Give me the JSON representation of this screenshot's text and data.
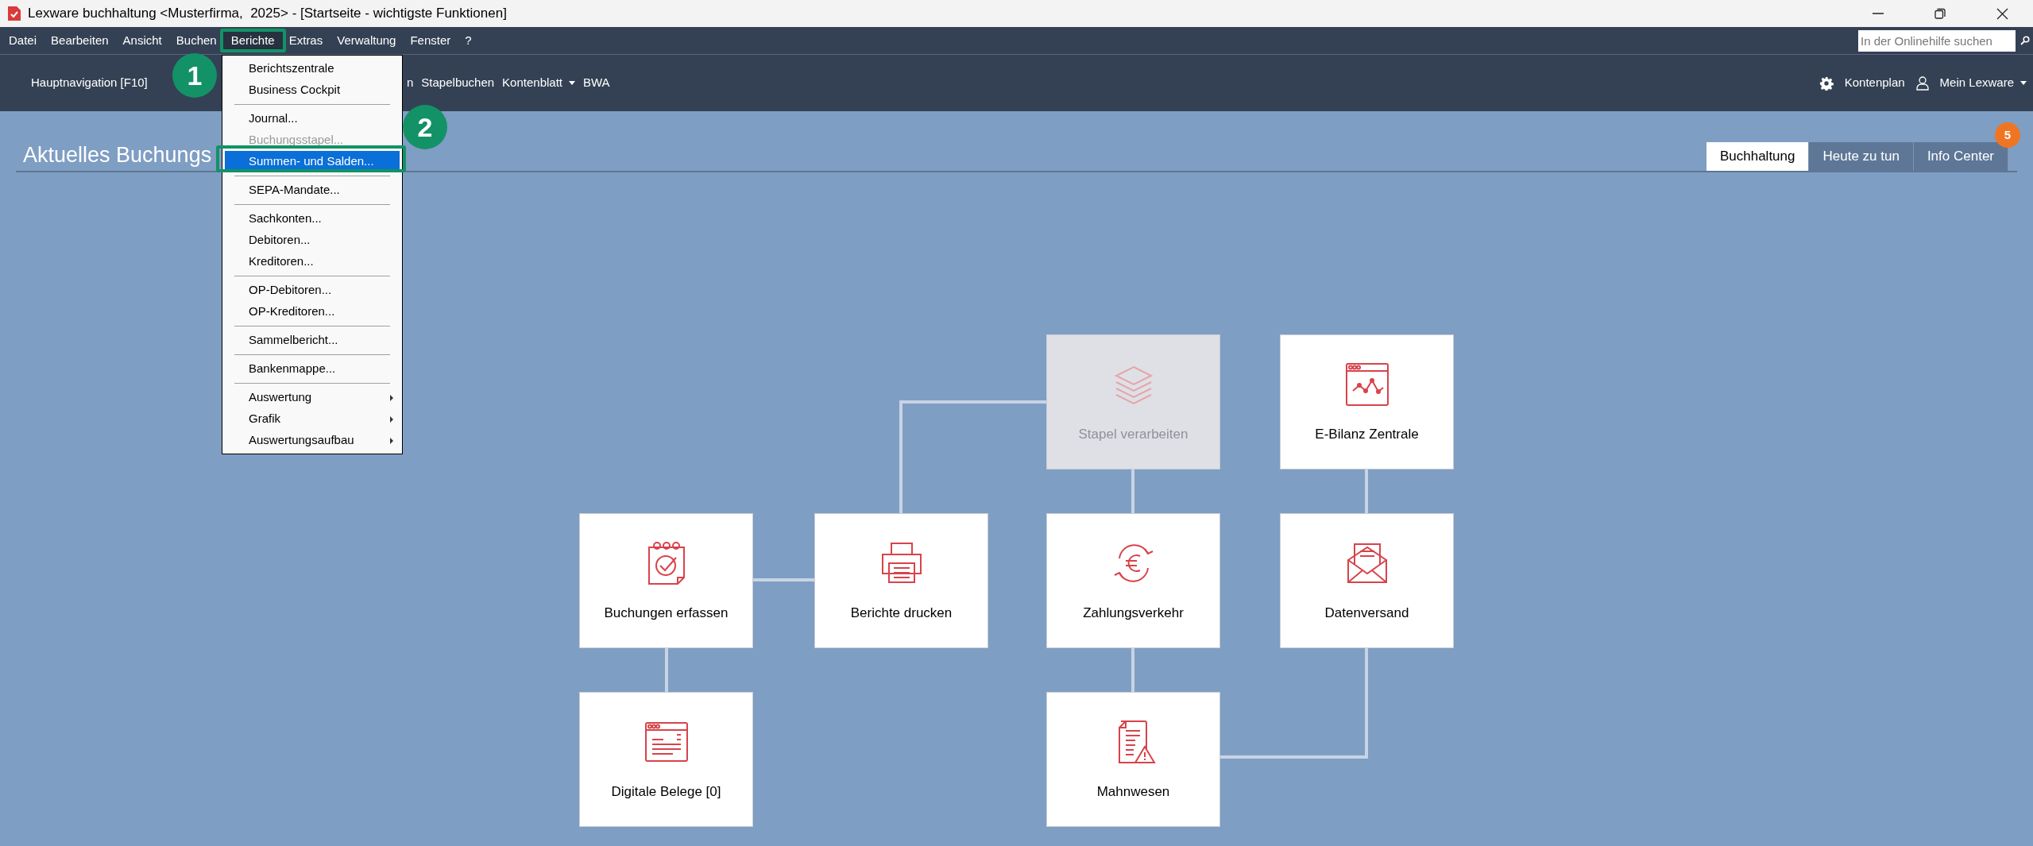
{
  "window": {
    "title": "Lexware buchhaltung <Musterfirma,  2025> - [Startseite - wichtigste Funktionen]"
  },
  "menubar": [
    {
      "label": "Datei",
      "selected": false
    },
    {
      "label": "Bearbeiten",
      "selected": false
    },
    {
      "label": "Ansicht",
      "selected": false
    },
    {
      "label": "Buchen",
      "selected": false
    },
    {
      "label": "Berichte",
      "selected": true
    },
    {
      "label": "Extras",
      "selected": false
    },
    {
      "label": "Verwaltung",
      "selected": false
    },
    {
      "label": "Fenster",
      "selected": false
    },
    {
      "label": "?",
      "selected": false
    }
  ],
  "help_search": {
    "placeholder": "In der Onlinehilfe suchen"
  },
  "nav": {
    "main": "Hauptnavigation [F10]",
    "items": [
      {
        "label": "n",
        "dropdown": false
      },
      {
        "label": "Stapelbuchen",
        "dropdown": false
      },
      {
        "label": "Kontenblatt",
        "dropdown": true
      },
      {
        "label": "BWA",
        "dropdown": false
      }
    ],
    "right": [
      {
        "label": "Kontenplan",
        "dropdown": false
      },
      {
        "label": "Mein Lexware",
        "dropdown": true
      }
    ]
  },
  "dropdown": [
    {
      "kind": "item",
      "label": "Berichtszentrale",
      "disabled": false,
      "selected": false,
      "submenu": false
    },
    {
      "kind": "item",
      "label": "Business Cockpit",
      "disabled": false,
      "selected": false,
      "submenu": false
    },
    {
      "kind": "separator"
    },
    {
      "kind": "item",
      "label": "Journal...",
      "disabled": false,
      "selected": false,
      "submenu": false
    },
    {
      "kind": "item",
      "label": "Buchungsstapel...",
      "disabled": true,
      "selected": false,
      "submenu": false
    },
    {
      "kind": "item",
      "label": "Summen- und Salden...",
      "disabled": false,
      "selected": true,
      "submenu": false
    },
    {
      "kind": "separator"
    },
    {
      "kind": "item",
      "label": "SEPA-Mandate...",
      "disabled": false,
      "selected": false,
      "submenu": false
    },
    {
      "kind": "separator"
    },
    {
      "kind": "item",
      "label": "Sachkonten...",
      "disabled": false,
      "selected": false,
      "submenu": false
    },
    {
      "kind": "item",
      "label": "Debitoren...",
      "disabled": false,
      "selected": false,
      "submenu": false
    },
    {
      "kind": "item",
      "label": "Kreditoren...",
      "disabled": false,
      "selected": false,
      "submenu": false
    },
    {
      "kind": "separator"
    },
    {
      "kind": "item",
      "label": "OP-Debitoren...",
      "disabled": false,
      "selected": false,
      "submenu": false
    },
    {
      "kind": "item",
      "label": "OP-Kreditoren...",
      "disabled": false,
      "selected": false,
      "submenu": false
    },
    {
      "kind": "separator"
    },
    {
      "kind": "item",
      "label": "Sammelbericht...",
      "disabled": false,
      "selected": false,
      "submenu": false
    },
    {
      "kind": "separator"
    },
    {
      "kind": "item",
      "label": "Bankenmappe...",
      "disabled": false,
      "selected": false,
      "submenu": false
    },
    {
      "kind": "separator"
    },
    {
      "kind": "item",
      "label": "Auswertung",
      "disabled": false,
      "selected": false,
      "submenu": true
    },
    {
      "kind": "item",
      "label": "Grafik",
      "disabled": false,
      "selected": false,
      "submenu": true
    },
    {
      "kind": "item",
      "label": "Auswertungsaufbau",
      "disabled": false,
      "selected": false,
      "submenu": true
    }
  ],
  "annotations": [
    {
      "label": "1"
    },
    {
      "label": "2"
    }
  ],
  "page_title": "Aktuelles Buchungs",
  "tabs": [
    {
      "label": "Buchhaltung",
      "selected": true
    },
    {
      "label": "Heute zu tun",
      "selected": false
    },
    {
      "label": "Info Center",
      "selected": false,
      "badge": "5"
    }
  ],
  "tiles": [
    {
      "kind": "stack",
      "label": "Stapel verarbeiten",
      "disabled": true
    },
    {
      "kind": "chart",
      "label": "E-Bilanz Zentrale",
      "disabled": false
    },
    {
      "kind": "notepad",
      "label": "Buchungen erfassen",
      "disabled": false
    },
    {
      "kind": "printer",
      "label": "Berichte drucken",
      "disabled": false
    },
    {
      "kind": "payment",
      "label": "Zahlungsverkehr",
      "disabled": false
    },
    {
      "kind": "mail",
      "label": "Datenversand",
      "disabled": false
    },
    {
      "kind": "document",
      "label": "Digitale Belege [0]",
      "disabled": false
    },
    {
      "kind": "dunning",
      "label": "Mahnwesen",
      "disabled": false
    }
  ]
}
